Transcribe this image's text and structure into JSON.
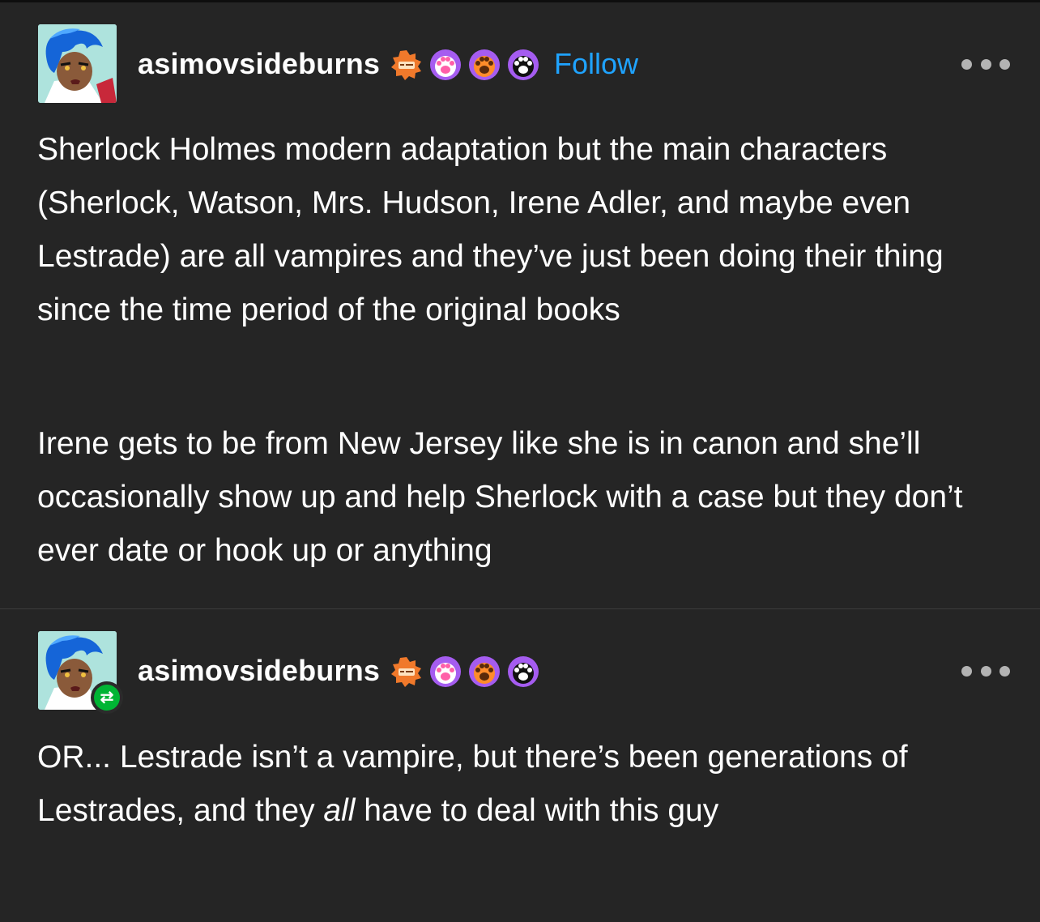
{
  "posts": [
    {
      "username": "asimovsideburns",
      "follow_label": "Follow",
      "badges": [
        "sun-badge-icon",
        "paw-badge-icon",
        "paw-badge-icon",
        "paw-badge-icon"
      ],
      "paragraphs": [
        "Sherlock Holmes modern adaptation but the main characters (Sherlock, Watson, Mrs. Hudson, Irene Adler, and maybe even Lestrade) are all vampires and they’ve just been doing their thing since the time period of the original books",
        "Irene gets to be from New Jersey like she is in canon and she’ll occasionally show up and help Sherlock with a case but they don’t ever date or hook up or anything"
      ]
    },
    {
      "username": "asimovsideburns",
      "reblog_icon": "reblog-icon",
      "badges": [
        "sun-badge-icon",
        "paw-badge-icon",
        "paw-badge-icon",
        "paw-badge-icon"
      ],
      "paragraph_parts": {
        "before": "OR... Lestrade isn’t a vampire, but there’s been generations of Lestrades, and they ",
        "emphasis": "all",
        "after": " have to deal with this guy"
      }
    }
  ],
  "colors": {
    "background": "#252525",
    "text": "#ffffff",
    "follow": "#1fa3ff",
    "reblog_green": "#00b534",
    "divider": "#3d3d3d"
  }
}
